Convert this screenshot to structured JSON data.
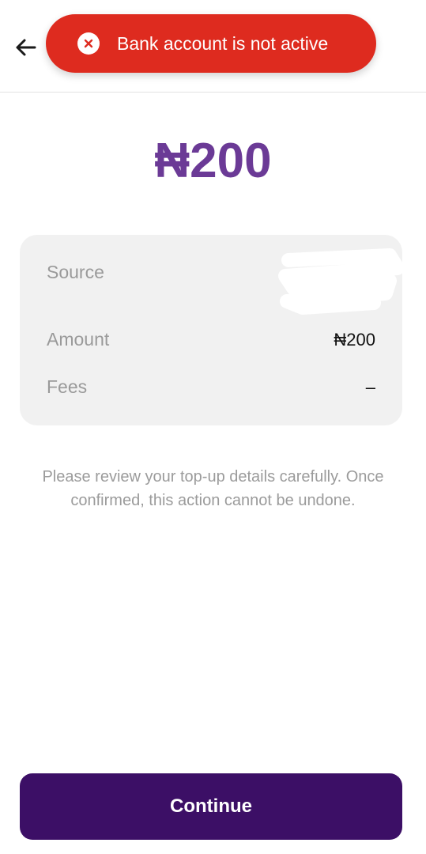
{
  "toast": {
    "message": "Bank account is not active",
    "icon": "close-circle-icon",
    "background": "#de2b1f"
  },
  "header": {
    "back_icon": "arrow-left-icon"
  },
  "summary": {
    "amount": "₦200",
    "amount_color": "#6b3a96"
  },
  "details": {
    "source_label": "Source",
    "source_value_redacted": true,
    "amount_label": "Amount",
    "amount_value": "₦200",
    "fees_label": "Fees",
    "fees_value": "–"
  },
  "disclaimer": "Please review your top-up details carefully. Once confirmed, this action cannot be undone.",
  "actions": {
    "continue_label": "Continue",
    "continue_color": "#3c0f66"
  }
}
